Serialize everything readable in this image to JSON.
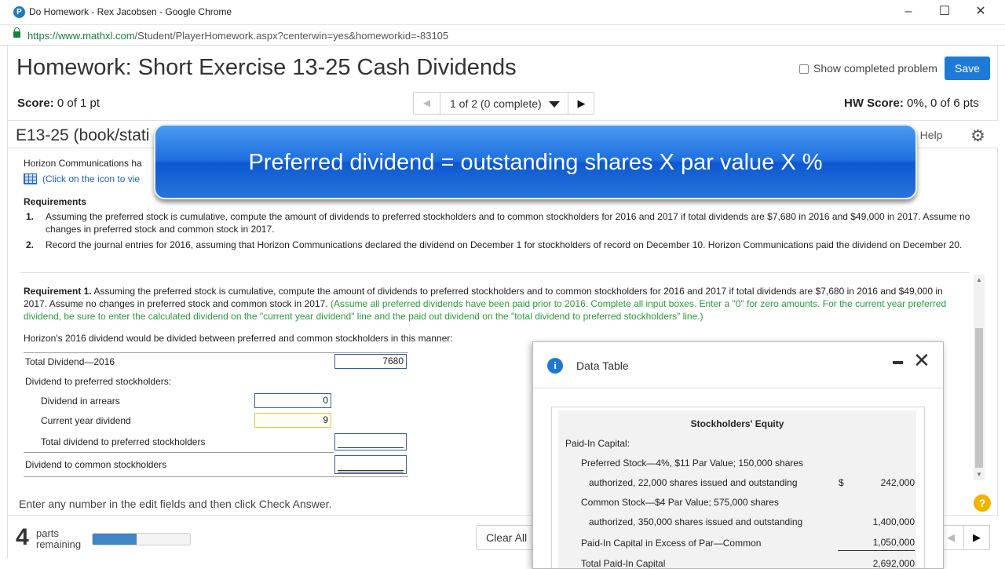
{
  "window": {
    "title": "Do Homework - Rex Jacobsen - Google Chrome",
    "url_host": "https://www.mathxl.com",
    "url_rest": "/Student/PlayerHomework.aspx?centerwin=yes&homeworkid=-83105",
    "min": "–",
    "max": "☐",
    "close": "✕"
  },
  "header": {
    "title": "Homework: Short Exercise 13-25 Cash Dividends",
    "show_completed": "Show completed problem",
    "save": "Save"
  },
  "score": {
    "label": "Score:",
    "value": "0 of 1 pt",
    "hw_label": "HW Score:",
    "hw_value": "0%, 0 of 6 pts"
  },
  "pager": {
    "prev": "◀",
    "label": "1 of 2 (0 complete)",
    "next": "▶"
  },
  "section": {
    "exercise": "E13-25 (book/stati",
    "help": "n Help",
    "gear": "⚙"
  },
  "banner": {
    "text": "Preferred dividend = outstanding shares X par value X %"
  },
  "intro": {
    "text": "Horizon Communications ha",
    "link": "(Click on the icon to vie"
  },
  "requirements": {
    "heading": "Requirements",
    "items": [
      {
        "num": "1.",
        "text": "Assuming the preferred stock is cumulative, compute the amount of dividends to preferred stockholders and to common stockholders for 2016 and 2017 if total dividends are $7,680 in 2016 and $49,000 in 2017. Assume no changes in preferred stock and common stock in 2017."
      },
      {
        "num": "2.",
        "text": "Record the journal entries for 2016, assuming that Horizon Communications declared the dividend on December 1 for stockholders of record on December 10. Horizon Communications paid the dividend on December 20."
      }
    ]
  },
  "requirement1": {
    "bold": "Requirement 1.",
    "text": " Assuming the preferred stock is cumulative, compute the amount of dividends to preferred stockholders and to common stockholders for 2016 and 2017 if total dividends are $7,680 in 2016 and $49,000 in 2017. Assume no changes in preferred stock and common stock in 2017. ",
    "green": "(Assume all preferred dividends have been paid prior to 2016. Complete all input boxes. Enter a \"0\" for zero amounts. For the current year preferred dividend, be sure to enter the calculated dividend on the \"current year dividend\" line and the paid out dividend on the \"total dividend to preferred stockholders\" line.)"
  },
  "worksheet": {
    "intro": "Horizon's 2016 dividend would be divided between preferred and common stockholders in this manner:",
    "total_label": "Total Dividend—2016",
    "total_value": "7680",
    "pref_label": "Dividend to preferred stockholders:",
    "arrears_label": "Dividend in arrears",
    "arrears_value": "0",
    "current_label": "Current year dividend",
    "current_value": "9",
    "total_pref_label": "Total dividend to preferred stockholders",
    "total_pref_value": "",
    "common_label": "Dividend to common stockholders",
    "common_value": ""
  },
  "footer": {
    "enter_note": "Enter any number in the edit fields and then click Check Answer.",
    "parts_num": "4",
    "parts_label1": "parts",
    "parts_label2": "remaining",
    "progress_fraction": 0.45,
    "clear_all": "Clear All",
    "prev": "◀",
    "next": "▶",
    "help": "?"
  },
  "data_table": {
    "title": "Data Table",
    "heading": "Stockholders' Equity",
    "paid_in": "Paid-In Capital:",
    "pref_line1": "Preferred Stock—4%, $11 Par Value; 150,000 shares",
    "pref_line2": "authorized, 22,000 shares issued and outstanding",
    "pref_dollar": "$",
    "pref_value": "242,000",
    "common_line1": "Common Stock—$4 Par Value; 575,000 shares",
    "common_line2": "authorized, 350,000 shares issued and outstanding",
    "common_value": "1,400,000",
    "excess_label": "Paid-In Capital in Excess of Par—Common",
    "excess_value": "1,050,000",
    "total_label": "Total Paid-In Capital",
    "total_value": "2,692,000"
  }
}
